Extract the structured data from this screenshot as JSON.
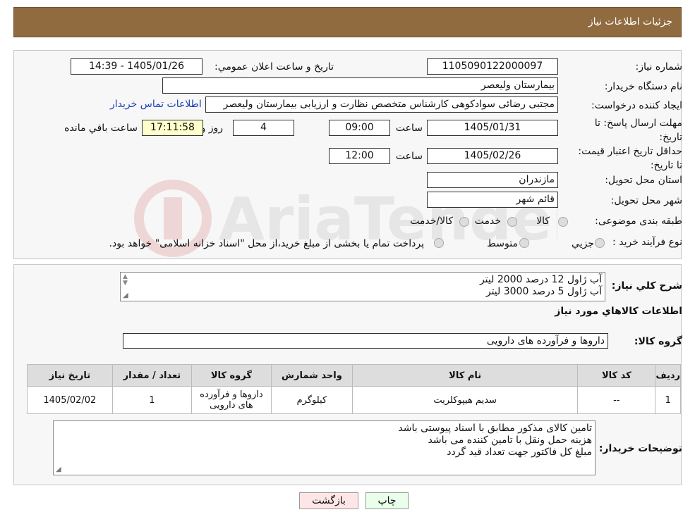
{
  "header": {
    "title": "جزئیات اطلاعات نیاز"
  },
  "form": {
    "need_number_label": "شماره نیاز:",
    "need_number": "1105090122000097",
    "announce_label": "تاریخ و ساعت اعلان عمومي:",
    "announce_value": "1405/01/26 - 14:39",
    "buyer_org_label": "نام دستگاه خریدار:",
    "buyer_org": "بیمارستان ولیعصر",
    "creator_label": "ایجاد کننده درخواست:",
    "creator": "مجتبی رضائی سوادکوهی کارشناس متخصص نظارت و ارزیابی بیمارستان ولیعصر",
    "contact_link": "اطلاعات تماس خریدار",
    "deadline_label": "مهلت ارسال پاسخ: تا تاریخ:",
    "deadline_date": "1405/01/31",
    "time_label": "ساعت",
    "deadline_time": "09:00",
    "days": "4",
    "days_label": "روز و",
    "remaining": "17:11:58",
    "remaining_label": "ساعت باقي مانده",
    "validity_label": "حداقل تاریخ اعتبار قیمت: تا تاریخ:",
    "validity_date": "1405/02/26",
    "validity_time": "12:00",
    "province_label": "استان محل تحویل:",
    "province": "مازندران",
    "city_label": "شهر محل تحویل:",
    "city": "قائم شهر",
    "category_label": "طبقه بندی موضوعی:",
    "category_options": [
      "کالا",
      "خدمت",
      "کالا/خدمت"
    ],
    "process_label": "نوع فرآیند خرید :",
    "process_options": [
      "جزیي",
      "متوسط"
    ],
    "process_note": "پرداخت تمام یا بخشی از مبلغ خرید،از محل \"اسناد خزانه اسلامی\" خواهد بود."
  },
  "description": {
    "label": "شرح کلي نیاز:",
    "lines": [
      "آب ژاول 12 درصد 2000 لیتر",
      "آب ژاول 5 درصد 3000 لیتر"
    ],
    "items_title": "اطلاعات کالاهاي مورد نیاز",
    "group_label": "گروه کالا:",
    "group_value": "داروها و فرآورده های دارویی"
  },
  "table": {
    "headers": [
      "ردیف",
      "کد کالا",
      "نام کالا",
      "واحد شمارش",
      "گروه کالا",
      "تعداد / مقدار",
      "تاریخ نیاز"
    ],
    "rows": [
      {
        "row": "1",
        "code": "--",
        "name": "سدیم هیپوکلریت",
        "unit": "کیلوگرم",
        "group": "داروها و فرآورده های دارویی",
        "qty": "1",
        "date": "1405/02/02"
      }
    ]
  },
  "buyer_notes": {
    "label": "توضیحات خریدار:",
    "lines": [
      "تامین کالای مذکور مطابق با اسناد پیوستی باشد",
      "هزینه حمل ونقل با تامین کننده می باشد",
      "مبلغ کل  فاکتور جهت تعداد قید گردد"
    ]
  },
  "buttons": {
    "print": "چاپ",
    "back": "بازگشت"
  },
  "colors": {
    "header": "#8f6b3f",
    "print_btn": "#eaffea",
    "back_btn": "#ffe6e6",
    "link": "#1a3fb3"
  }
}
